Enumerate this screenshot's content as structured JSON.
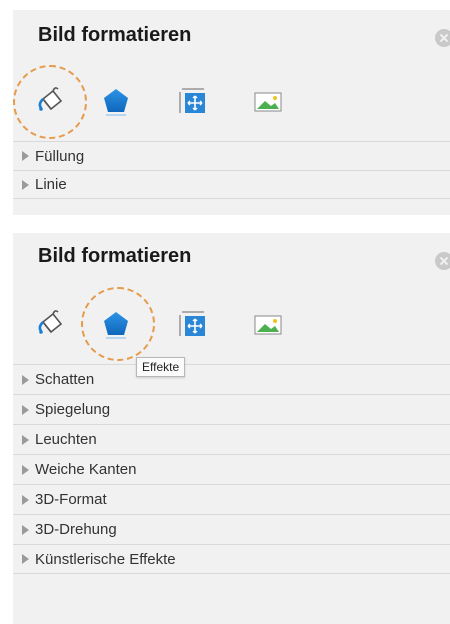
{
  "panel_top": {
    "title": "Bild formatieren",
    "sections": [
      "Füllung",
      "Linie"
    ]
  },
  "panel_bottom": {
    "title": "Bild formatieren",
    "tooltip": "Effekte",
    "sections": [
      "Schatten",
      "Spiegelung",
      "Leuchten",
      "Weiche Kanten",
      "3D-Format",
      "3D-Drehung",
      "Künstlerische Effekte"
    ]
  },
  "icons": {
    "tab_fill": "paint-bucket-icon",
    "tab_effects": "pentagon-icon",
    "tab_layout": "size-layout-icon",
    "tab_picture": "picture-icon",
    "close": "close-icon",
    "expand": "triangle-right-icon"
  },
  "colors": {
    "panel_bg": "#f1f1f1",
    "accent_blue": "#1a7fd4",
    "highlight_orange": "#e69a4a"
  }
}
